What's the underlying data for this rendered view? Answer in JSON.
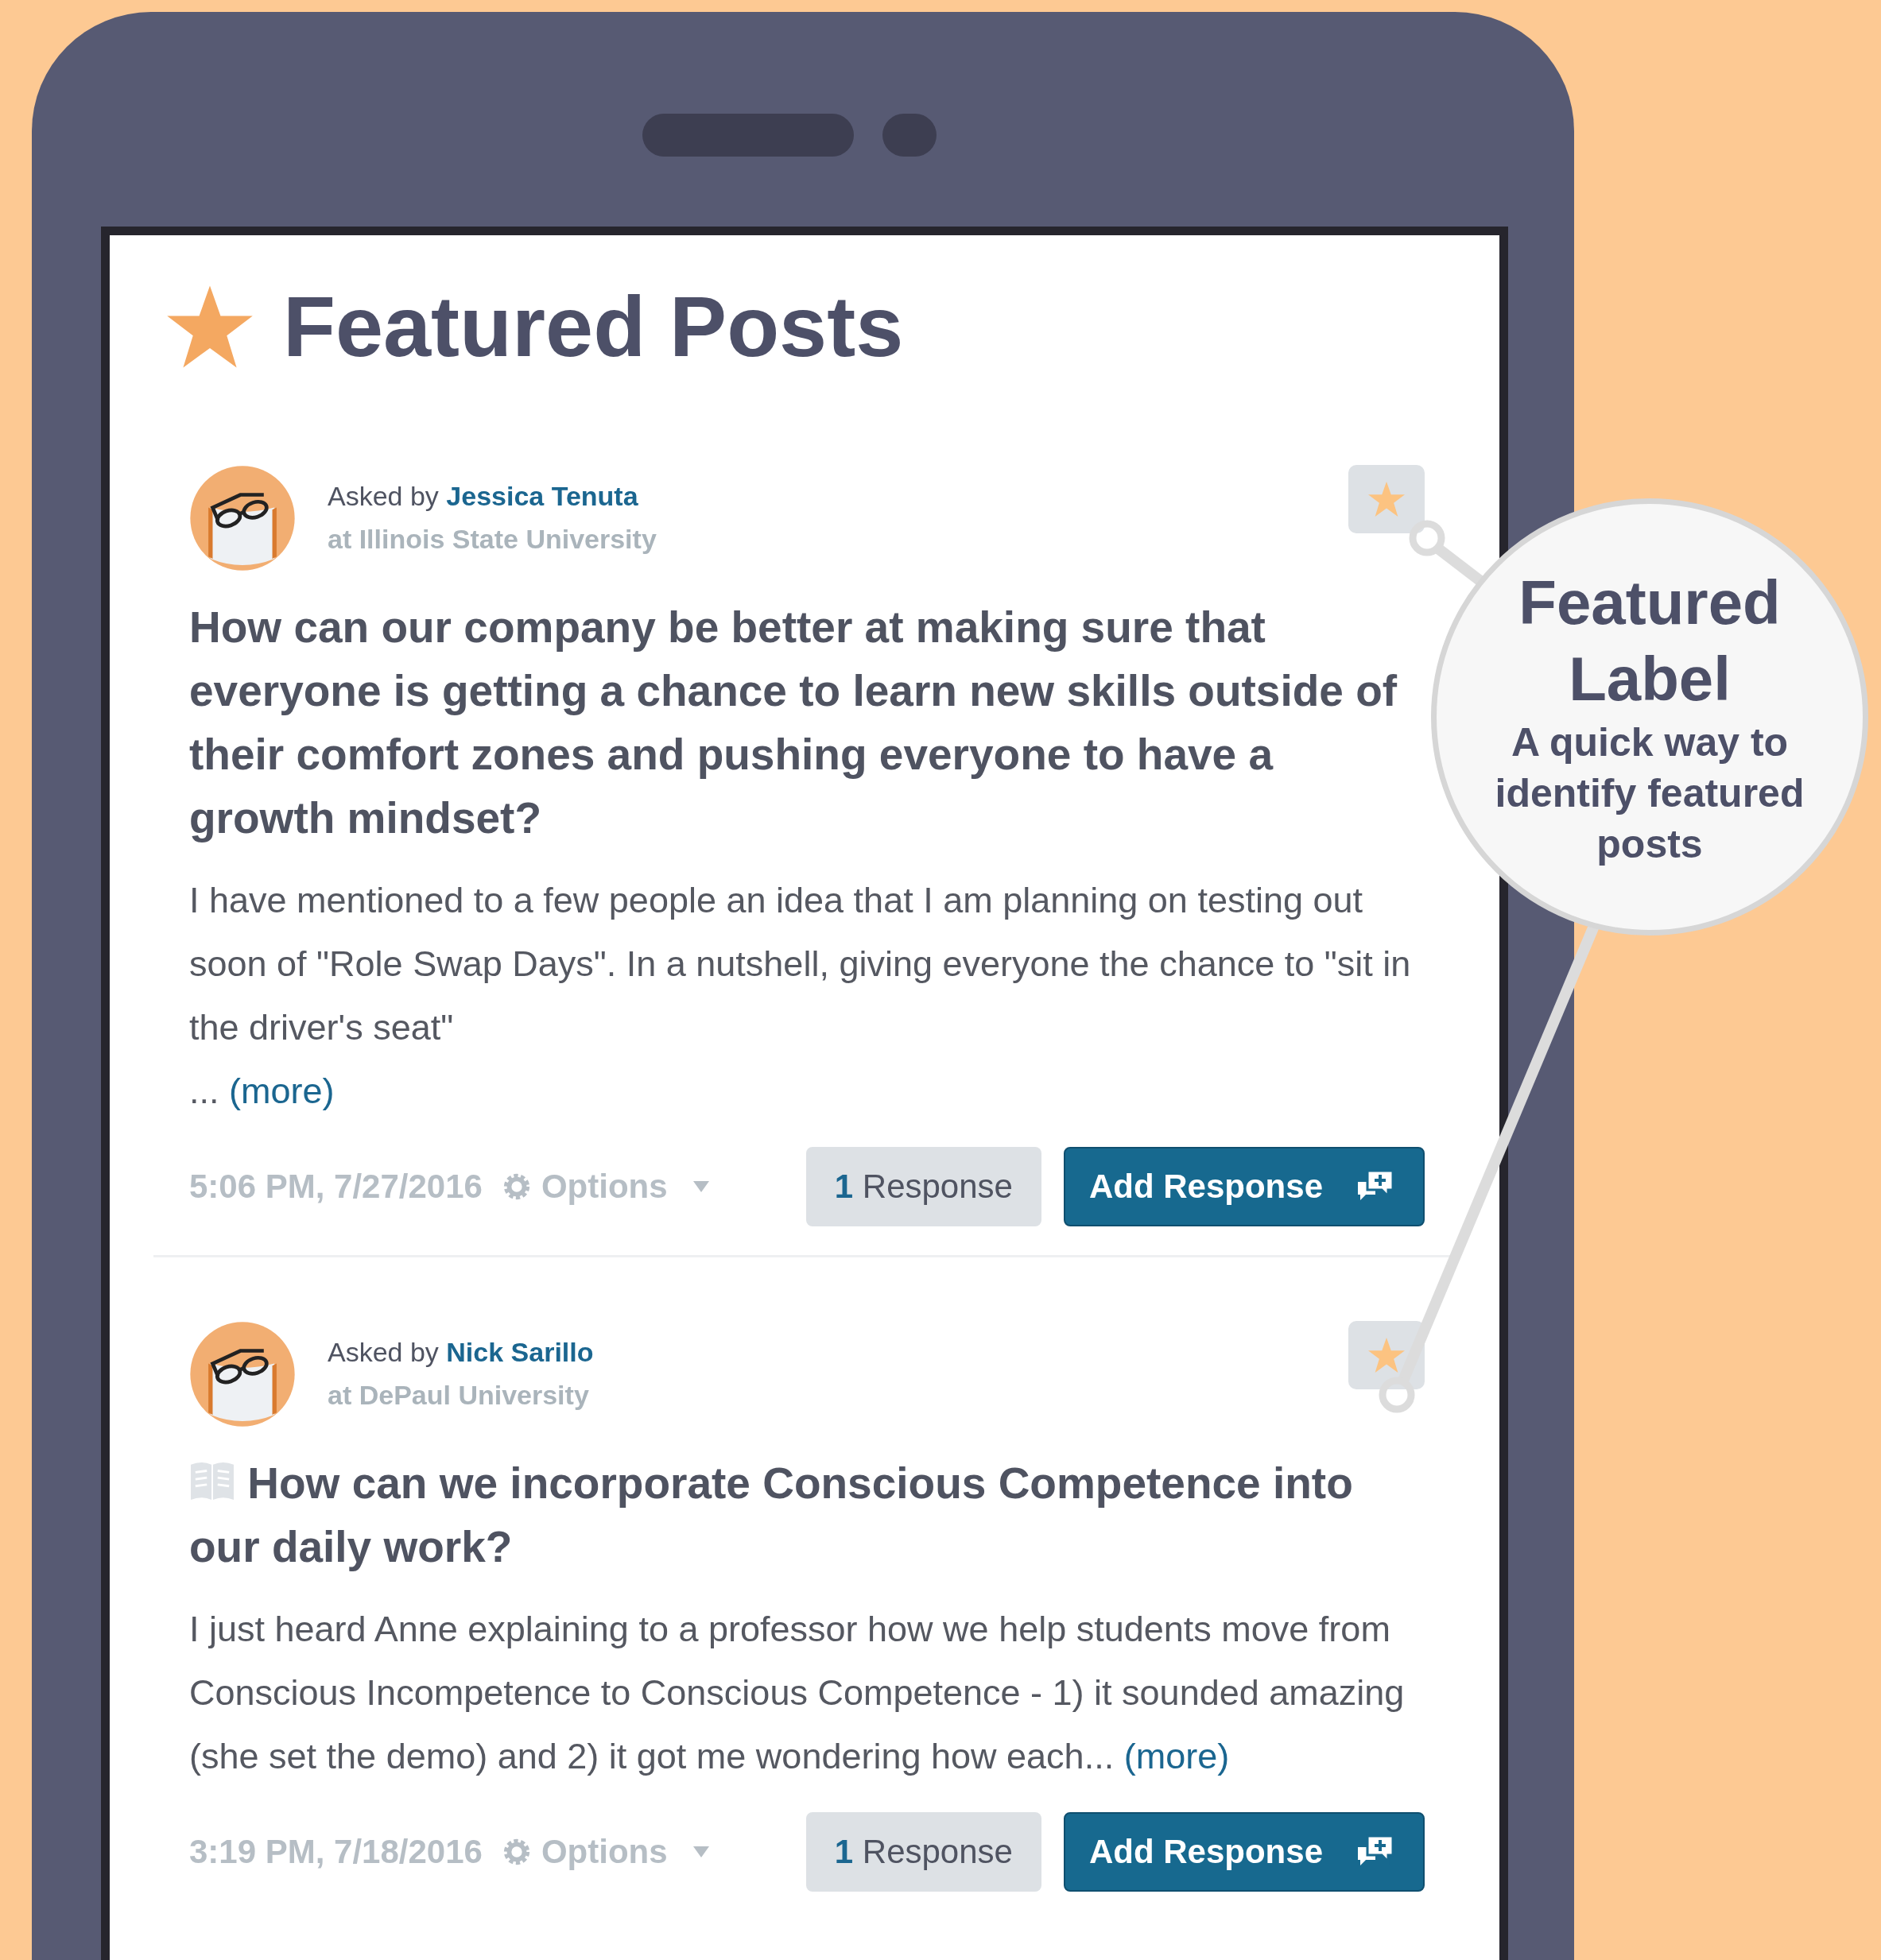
{
  "page_title": "Featured Posts",
  "posts": [
    {
      "asked_by": "Asked by",
      "author": "Jessica Tenuta",
      "school": "at Illinois State University",
      "featured": true,
      "question_icon": false,
      "question": "How can our company be better at making sure that everyone is getting a chance to learn new skills outside of their comfort zones and pushing everyone to have a growth mindset?",
      "body": "I have mentioned to a few people an idea that I am planning on testing out soon of \"Role Swap Days\". In a nutshell, giving everyone the chance to \"sit in the driver's seat\"",
      "more_line": {
        "prefix": "...",
        "link": "(more)"
      },
      "time": "5:06 PM, 7/27/2016",
      "options": "Options",
      "response_count": "1",
      "response_label": "Response",
      "add_response": "Add Response"
    },
    {
      "asked_by": "Asked by",
      "author": "Nick Sarillo",
      "school": "at DePaul University",
      "featured": true,
      "question_icon": true,
      "question": "How can we incorporate Conscious Competence into our daily work?",
      "body": "I just heard Anne explaining to a professor how we help students move from Conscious Incompetence to Conscious Competence - 1) it sounded amazing (she set the demo) and 2) it got me wondering how each",
      "more_inline": {
        "prefix": "...",
        "link": "(more)"
      },
      "time": "3:19 PM, 7/18/2016",
      "options": "Options",
      "response_count": "1",
      "response_label": "Response",
      "add_response": "Add Response"
    }
  ],
  "callout": {
    "title": "Featured Label",
    "text": "A quick way to identify featured posts"
  }
}
